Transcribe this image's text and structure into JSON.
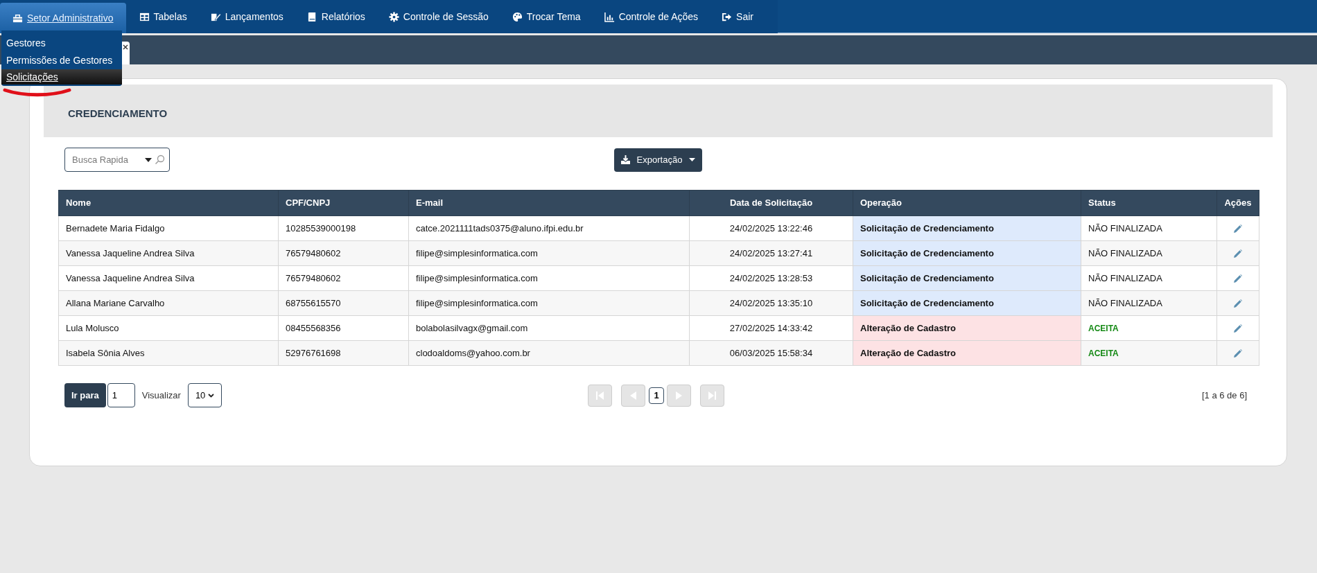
{
  "nav": {
    "items": [
      {
        "label": "Setor Administrativo",
        "selected": true
      },
      {
        "label": "Tabelas",
        "selected": false
      },
      {
        "label": "Lançamentos",
        "selected": false
      },
      {
        "label": "Relatórios",
        "selected": false
      },
      {
        "label": "Controle de Sessão",
        "selected": false
      },
      {
        "label": "Trocar Tema",
        "selected": false
      },
      {
        "label": "Controle de Ações",
        "selected": false
      },
      {
        "label": "Sair",
        "selected": false
      }
    ]
  },
  "dropdown": {
    "items": [
      {
        "label": "Gestores",
        "selected": false
      },
      {
        "label": "Permissões de Gestores",
        "selected": false
      },
      {
        "label": "Solicitações",
        "selected": true
      }
    ]
  },
  "panel": {
    "title": "CREDENCIAMENTO"
  },
  "search": {
    "placeholder": "Busca Rapida"
  },
  "export_button": {
    "label": "Exportação"
  },
  "table": {
    "columns": [
      "Nome",
      "CPF/CNPJ",
      "E-mail",
      "Data de Solicitação",
      "Operação",
      "Status",
      "Ações"
    ],
    "rows": [
      {
        "name": "Bernadete Maria Fidalgo",
        "doc": "10285539000198",
        "email": "catce.2021111tads0375@aluno.ifpi.edu.br",
        "date": "24/02/2025 13:22:46",
        "operation": {
          "text": "Solicitação de Credenciamento",
          "color": "#deeafc"
        },
        "status": {
          "text": "NÃO FINALIZADA",
          "color": "#111111"
        }
      },
      {
        "name": "Vanessa Jaqueline Andrea Silva",
        "doc": "76579480602",
        "email": "filipe@simplesinformatica.com",
        "date": "24/02/2025 13:27:41",
        "operation": {
          "text": "Solicitação de Credenciamento",
          "color": "#deeafc"
        },
        "status": {
          "text": "NÃO FINALIZADA",
          "color": "#111111"
        }
      },
      {
        "name": "Vanessa Jaqueline Andrea Silva",
        "doc": "76579480602",
        "email": "filipe@simplesinformatica.com",
        "date": "24/02/2025 13:28:53",
        "operation": {
          "text": "Solicitação de Credenciamento",
          "color": "#deeafc"
        },
        "status": {
          "text": "NÃO FINALIZADA",
          "color": "#111111"
        }
      },
      {
        "name": "Allana Mariane Carvalho",
        "doc": "68755615570",
        "email": "filipe@simplesinformatica.com",
        "date": "24/02/2025 13:35:10",
        "operation": {
          "text": "Solicitação de Credenciamento",
          "color": "#deeafc"
        },
        "status": {
          "text": "NÃO FINALIZADA",
          "color": "#111111"
        }
      },
      {
        "name": "Lula Molusco",
        "doc": "08455568356",
        "email": "bolabolasilvagx@gmail.com",
        "date": "27/02/2025 14:33:42",
        "operation": {
          "text": "Alteração de Cadastro",
          "color": "#fde2e4"
        },
        "status": {
          "text": "ACEITA",
          "color": "#168a16"
        }
      },
      {
        "name": "Isabela Sônia Alves",
        "doc": "52976761698",
        "email": "clodoaldoms@yahoo.com.br",
        "date": "06/03/2025 15:58:34",
        "operation": {
          "text": "Alteração de Cadastro",
          "color": "#fde2e4"
        },
        "status": {
          "text": "ACEITA",
          "color": "#168a16"
        }
      }
    ]
  },
  "pagination": {
    "goto_label": "Ir para",
    "goto_value": "1",
    "view_label": "Visualizar",
    "page_size": "10",
    "current_page": "1",
    "summary": "[1 a 6 de 6]"
  }
}
